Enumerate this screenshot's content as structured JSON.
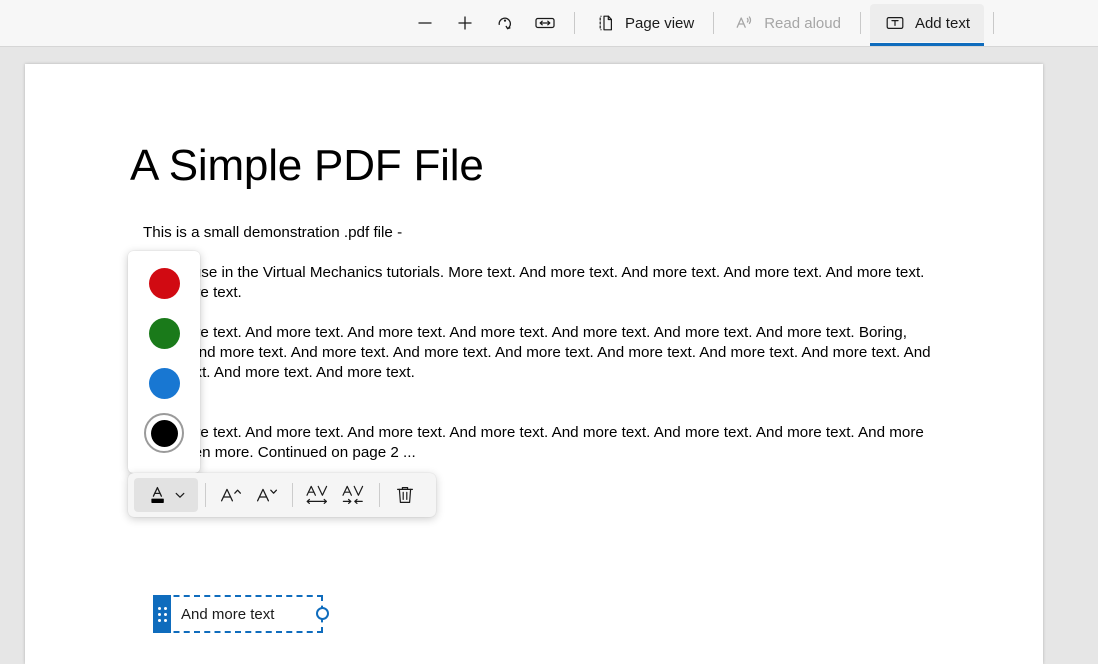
{
  "toolbar": {
    "zoom_out_label": "Zoom out",
    "zoom_in_label": "Zoom in",
    "rotate_label": "Rotate",
    "fit_width_label": "Fit to width",
    "page_view_label": "Page view",
    "read_aloud_label": "Read aloud",
    "add_text_label": "Add text",
    "active_tab": "Add text",
    "accent_color": "#0f6cbd"
  },
  "document": {
    "title": "A Simple PDF File",
    "paragraphs": [
      "This is a small demonstration .pdf file -",
      "just for use in the Virtual Mechanics tutorials. More text. And more text. And more text. And more text. And more text. And more text.",
      "And more text. And more text. And more text. And more text. And more text. And more text. And more text. Boring, zzzzz. And more text. And more text. And more text. And more text. And more text. And more text. And more text. And more text. And more text. And more text.",
      "And more text. And more text. And more text. And more text. And more text. And more text. And more text. And more text. Even more. Continued on page 2 ..."
    ]
  },
  "color_picker": {
    "swatches": [
      {
        "name": "red",
        "color": "#d10a12",
        "selected": false
      },
      {
        "name": "green",
        "color": "#1a7a1a",
        "selected": false
      },
      {
        "name": "blue",
        "color": "#1877d2",
        "selected": false
      },
      {
        "name": "black",
        "color": "#000000",
        "selected": true
      }
    ],
    "selected_color": "#000000"
  },
  "text_toolbar": {
    "color_label": "Text color",
    "color_swatch": "#000000",
    "increase_font_label": "Increase font size",
    "decrease_font_label": "Decrease font size",
    "increase_spacing_label": "Increase text spacing",
    "decrease_spacing_label": "Decrease text spacing",
    "delete_label": "Delete"
  },
  "text_box": {
    "value": "And more text",
    "border_color": "#0f6cbd"
  }
}
